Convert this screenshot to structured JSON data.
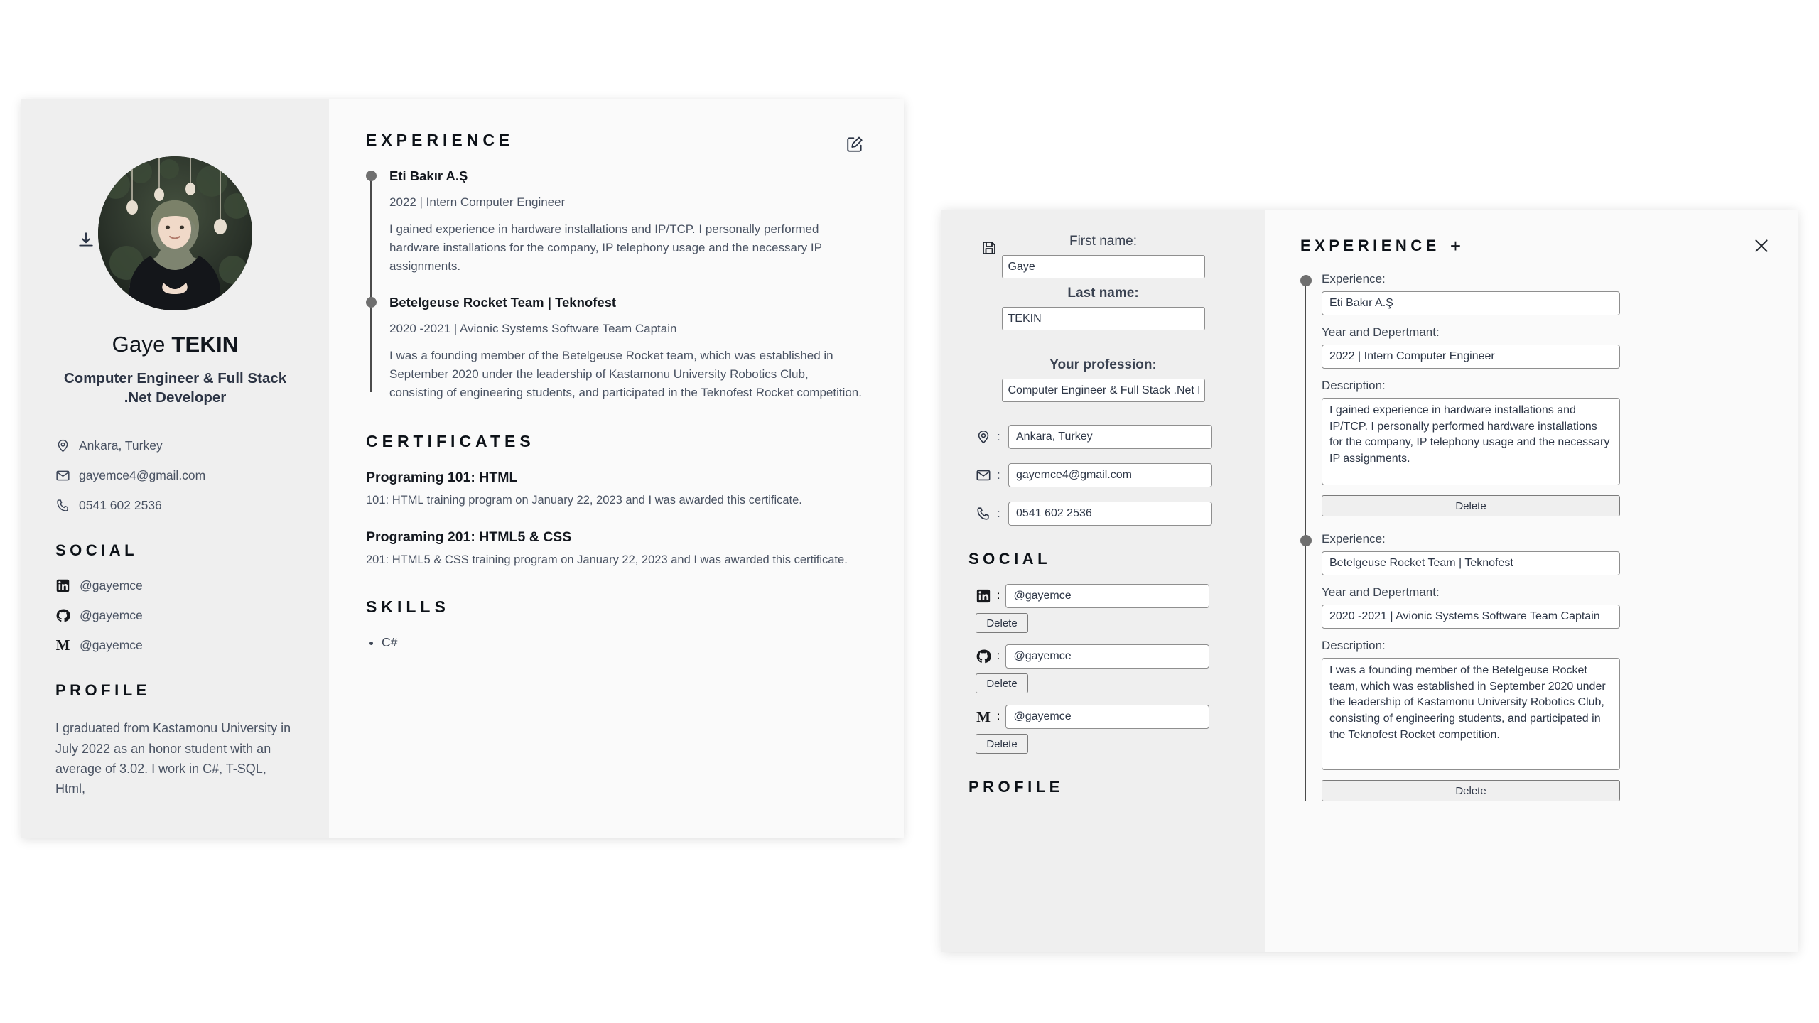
{
  "resume": {
    "sidebar": {
      "download_icon": "download-icon",
      "first_name": "Gaye",
      "last_name": "TEKIN",
      "profession": "Computer Engineer & Full Stack .Net Developer",
      "contacts": [
        {
          "icon": "location-pin-icon",
          "value": "Ankara, Turkey"
        },
        {
          "icon": "envelope-icon",
          "value": "gayemce4@gmail.com"
        },
        {
          "icon": "phone-icon",
          "value": "0541 602 2536"
        }
      ],
      "social_heading": "SOCIAL",
      "socials": [
        {
          "icon": "linkedin-icon",
          "value": "@gayemce"
        },
        {
          "icon": "github-icon",
          "value": "@gayemce"
        },
        {
          "icon": "medium-icon",
          "value": "@gayemce"
        }
      ],
      "profile_heading": "PROFILE",
      "profile_text": "I graduated from Kastamonu University in July 2022 as an honor student with an average of 3.02. I work in C#, T-SQL, Html,"
    },
    "main": {
      "experience_heading": "EXPERIENCE",
      "edit_icon": "edit-pencil-icon",
      "experiences": [
        {
          "title": "Eti Bakır A.Ş",
          "meta": "2022 | Intern Computer Engineer",
          "description": "I gained experience in hardware installations and IP/TCP. I personally performed hardware installations for the company, IP telephony usage and the necessary IP assignments."
        },
        {
          "title": "Betelgeuse Rocket Team | Teknofest",
          "meta": "2020 -2021 | Avionic Systems Software Team Captain",
          "description": "I was a founding member of the Betelgeuse Rocket team, which was established in September 2020 under the leadership of Kastamonu University Robotics Club, consisting of engineering students, and participated in the Teknofest Rocket competition."
        }
      ],
      "certificates_heading": "CERTIFICATES",
      "certificates": [
        {
          "title": "Programing 101: HTML",
          "description": "101: HTML training program on January 22, 2023 and I was awarded this certificate."
        },
        {
          "title": "Programing 201: HTML5 & CSS",
          "description": "201: HTML5 & CSS training program on January 22, 2023 and I was awarded this certificate."
        }
      ],
      "skills_heading": "SKILLS",
      "skills": [
        "C#"
      ]
    }
  },
  "editor": {
    "left": {
      "save_icon": "save-disk-icon",
      "first_name_label": "First name:",
      "first_name_value": "Gaye",
      "last_name_label": "Last name:",
      "last_name_value": "TEKIN",
      "profession_label": "Your profession:",
      "profession_value": "Computer Engineer & Full Stack .Net Developer",
      "contacts": [
        {
          "icon": "location-pin-icon",
          "separator": ":",
          "value": "Ankara, Turkey"
        },
        {
          "icon": "envelope-icon",
          "separator": ":",
          "value": "gayemce4@gmail.com"
        },
        {
          "icon": "phone-icon",
          "separator": ":",
          "value": "0541 602 2536"
        }
      ],
      "social_heading": "SOCIAL",
      "socials": [
        {
          "icon": "linkedin-icon",
          "separator": ":",
          "value": "@gayemce",
          "delete_label": "Delete"
        },
        {
          "icon": "github-icon",
          "separator": ":",
          "value": "@gayemce",
          "delete_label": "Delete"
        },
        {
          "icon": "medium-icon",
          "separator": ":",
          "value": "@gayemce",
          "delete_label": "Delete"
        }
      ],
      "profile_heading": "PROFILE"
    },
    "right": {
      "heading": "EXPERIENCE",
      "add_label": "+",
      "close_icon": "close-x-icon",
      "experience_label": "Experience:",
      "year_label": "Year and Depertmant:",
      "description_label": "Description:",
      "delete_label": "Delete",
      "items": [
        {
          "experience": "Eti Bakır A.Ş",
          "year": "2022 | Intern Computer Engineer",
          "description": "I gained experience in hardware installations and IP/TCP. I personally performed hardware installations for the company, IP telephony usage and the necessary IP assignments."
        },
        {
          "experience": "Betelgeuse Rocket Team | Teknofest",
          "year": "2020 -2021 | Avionic Systems Software Team Captain",
          "description": "I was a founding member of the Betelgeuse Rocket team, which was established in September 2020 under the leadership of Kastamonu University Robotics Club, consisting of engineering students, and participated in the Teknofest Rocket competition."
        }
      ]
    }
  },
  "colors": {
    "panel_bg": "#fafafa",
    "sidebar_bg": "#efefef",
    "heading": "#0d1218",
    "body_text": "#4a5363",
    "timeline": "#6f6f6f"
  }
}
